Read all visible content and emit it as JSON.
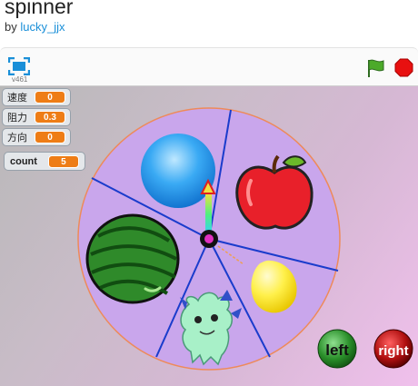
{
  "project": {
    "title": "spinner",
    "by_prefix": "by",
    "author": "lucky_jjx"
  },
  "toolbar": {
    "version": "v461",
    "fullscreen_icon": "fullscreen-icon",
    "flag_icon": "green-flag-icon",
    "stop_icon": "stop-sign-icon"
  },
  "monitors": [
    {
      "label": "速度",
      "value": "0"
    },
    {
      "label": "阻力",
      "value": "0.3"
    },
    {
      "label": "方向",
      "value": "0"
    },
    {
      "label": "count",
      "value": "5"
    }
  ],
  "wheel": {
    "segments": [
      "ball",
      "apple",
      "lemon",
      "monster",
      "watermelon"
    ],
    "fill_color": "#c9a6ec",
    "divider_color": "#1a3ccc",
    "rim_color": "#ee8a5a"
  },
  "buttons": {
    "left_label": "left",
    "right_label": "right"
  },
  "colors": {
    "link": "#1a8fd8",
    "monitor_value": "#ee7d16",
    "left_button": "#2a8f2a",
    "right_button": "#b01010"
  }
}
